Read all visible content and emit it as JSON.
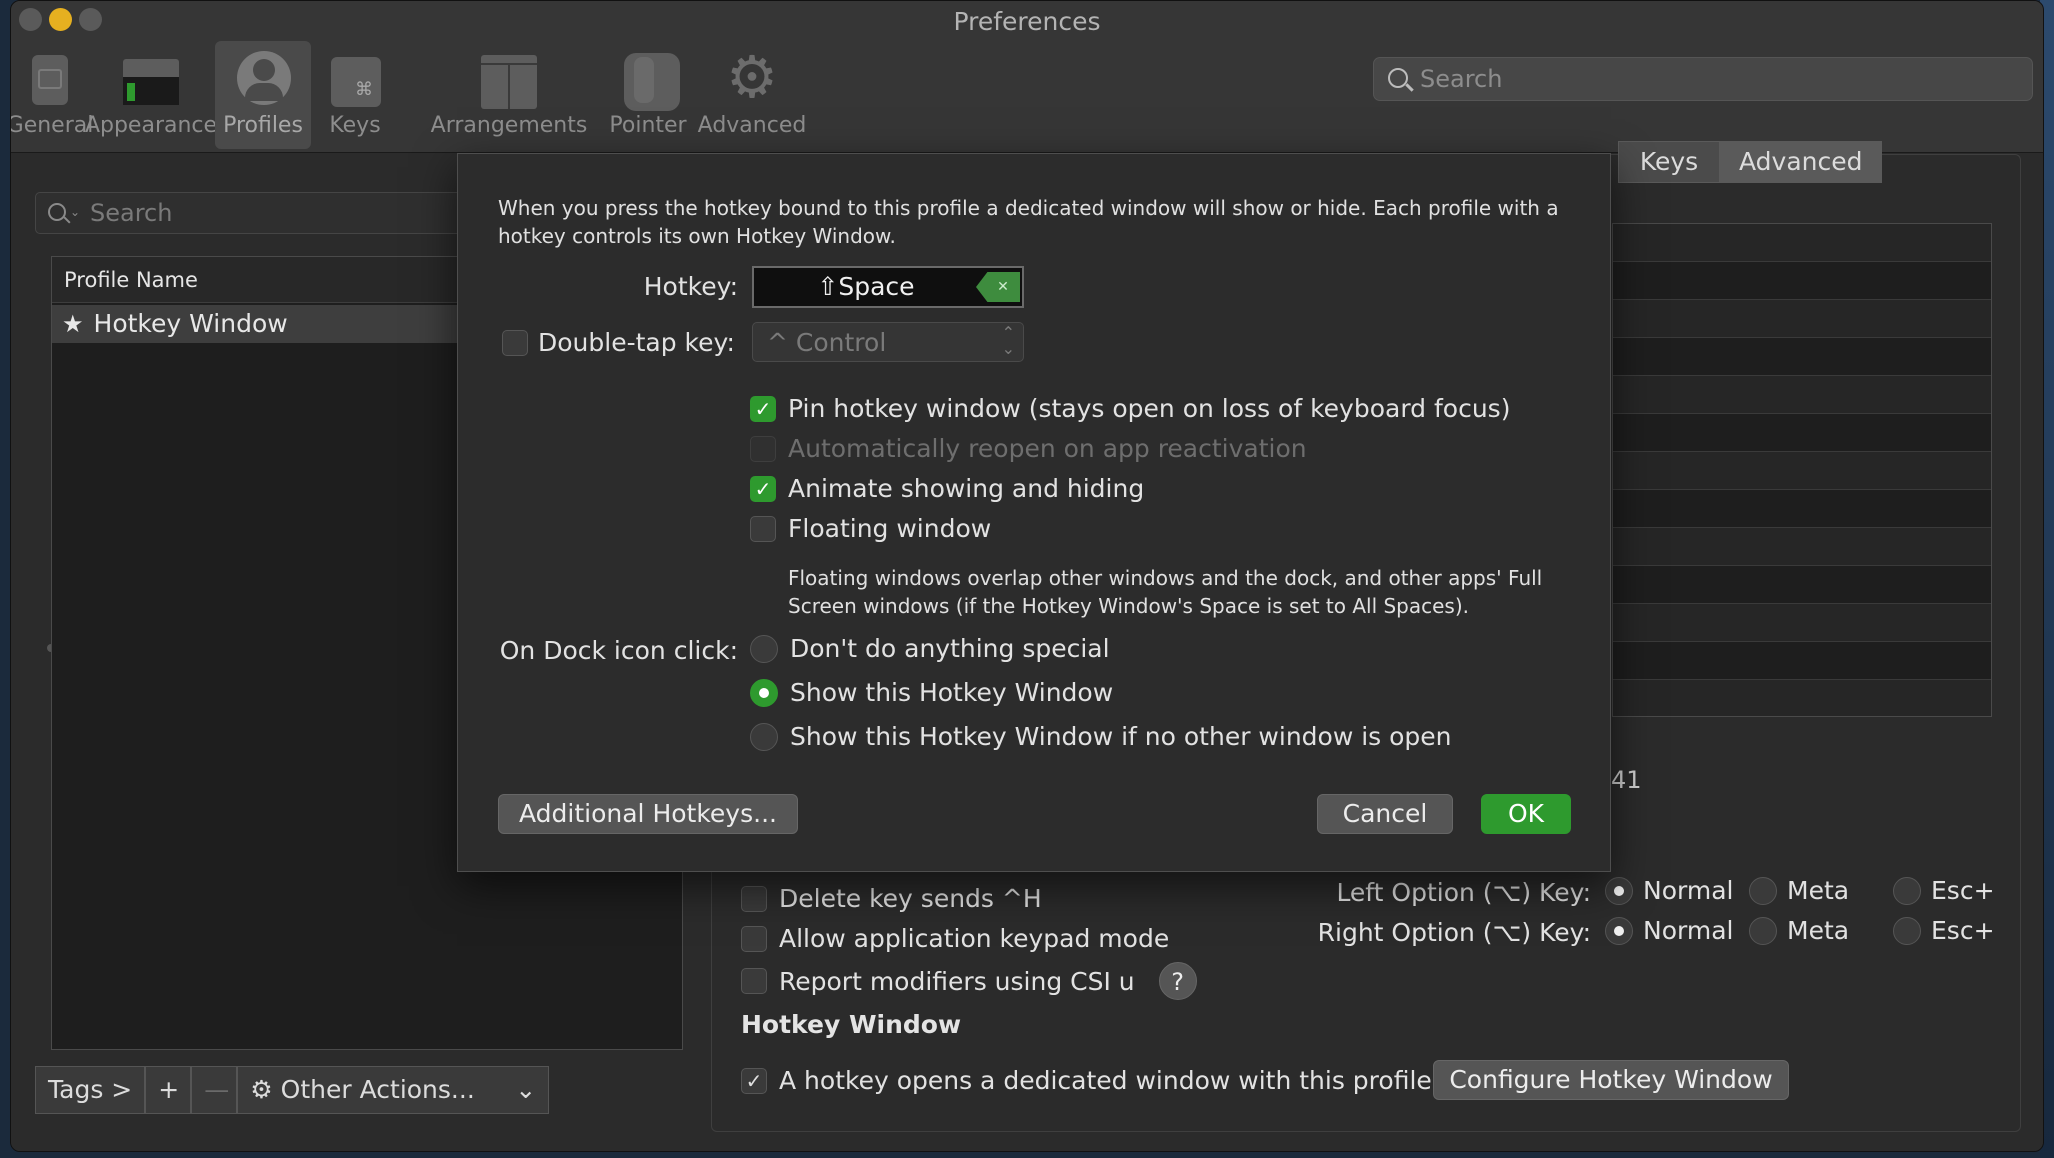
{
  "window": {
    "title": "Preferences"
  },
  "toolbar": {
    "items": [
      {
        "label": "General",
        "icon": "general-icon"
      },
      {
        "label": "Appearance",
        "icon": "appearance-icon"
      },
      {
        "label": "Profiles",
        "icon": "profiles-icon",
        "selected": true
      },
      {
        "label": "Keys",
        "icon": "keys-icon"
      },
      {
        "label": "Arrangements",
        "icon": "arrangements-icon"
      },
      {
        "label": "Pointer",
        "icon": "pointer-icon"
      },
      {
        "label": "Advanced",
        "icon": "gear-icon"
      }
    ],
    "search_placeholder": "Search"
  },
  "profiles_list": {
    "search_placeholder": "Search",
    "column_header": "Profile Name",
    "items": [
      {
        "name": "Hotkey Window",
        "icon": "star-icon",
        "default": true
      }
    ],
    "tags_button": "Tags >",
    "add_button": "+",
    "remove_button": "—",
    "other_actions": "Other Actions...",
    "other_actions_icon": "gear-icon"
  },
  "profile_tabs": {
    "keys": "Keys",
    "advanced": "Advanced"
  },
  "background_table_tail": "41",
  "keys_settings": {
    "delete_sends_h": {
      "label": "Delete key sends ^H",
      "checked": false
    },
    "keypad_mode": {
      "label": "Allow application keypad mode",
      "checked": false
    },
    "report_modifiers": {
      "label": "Report modifiers using CSI u",
      "checked": false
    },
    "help_label": "?",
    "left_option_label": "Left Option (⌥) Key:",
    "right_option_label": "Right Option (⌥) Key:",
    "option_choices": [
      "Normal",
      "Meta",
      "Esc+"
    ],
    "left_option_selected": "Normal",
    "right_option_selected": "Normal",
    "hotkey_section_title": "Hotkey Window",
    "hotkey_opens": {
      "label": "A hotkey opens a dedicated window with this profile.",
      "checked": true
    },
    "configure_button": "Configure Hotkey Window"
  },
  "hotkey_sheet": {
    "description": "When you press the hotkey bound to this profile a dedicated window will show or hide. Each profile with a hotkey controls its own Hotkey Window.",
    "hotkey_label": "Hotkey:",
    "hotkey_value": "⇧Space",
    "double_tap_label": "Double-tap key:",
    "double_tap_checked": false,
    "double_tap_value": "^ Control",
    "options": [
      {
        "label": "Pin hotkey window (stays open on loss of keyboard focus)",
        "checked": true,
        "enabled": true
      },
      {
        "label": "Automatically reopen on app reactivation",
        "checked": false,
        "enabled": false
      },
      {
        "label": "Animate showing and hiding",
        "checked": true,
        "enabled": true
      },
      {
        "label": "Floating window",
        "checked": false,
        "enabled": true
      }
    ],
    "floating_note": "Floating windows overlap other windows and the dock, and other apps' Full Screen windows (if the Hotkey Window's Space is set to All Spaces).",
    "dock_click_label": "On Dock icon click:",
    "dock_options": [
      {
        "label": "Don't do anything special",
        "selected": false
      },
      {
        "label": "Show this Hotkey Window",
        "selected": true
      },
      {
        "label": "Show this Hotkey Window if no other window is open",
        "selected": false
      }
    ],
    "additional_hotkeys_button": "Additional Hotkeys...",
    "cancel_button": "Cancel",
    "ok_button": "OK"
  },
  "colors": {
    "accent": "#2e9a2e",
    "window_bg": "#2b2b2b",
    "titlebar_bg": "#363636"
  }
}
